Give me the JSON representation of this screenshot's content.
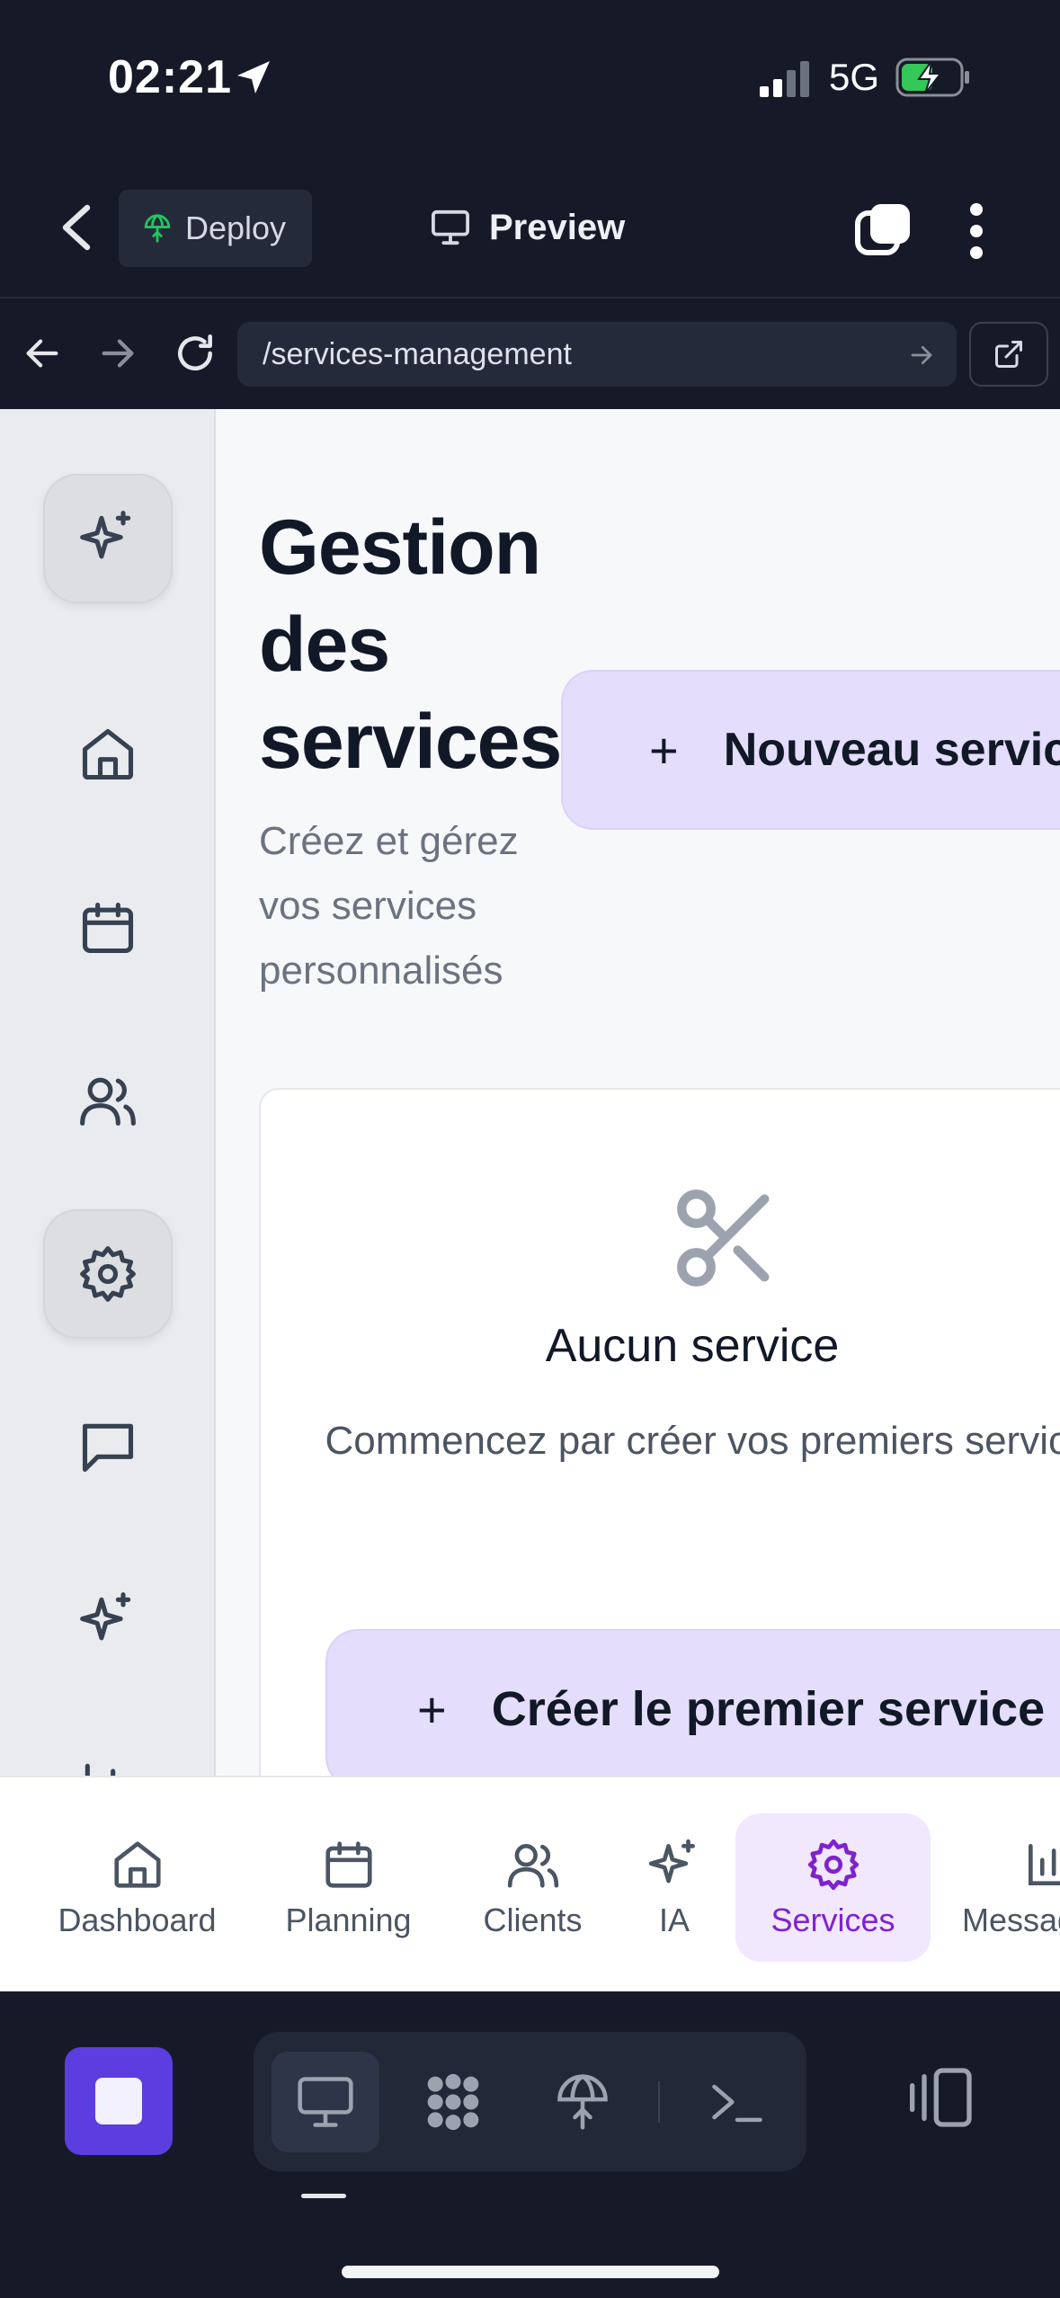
{
  "status": {
    "time": "02:21",
    "network": "5G"
  },
  "header": {
    "deploy_label": "Deploy",
    "preview_label": "Preview"
  },
  "browser": {
    "url": "/services-management"
  },
  "page": {
    "title": "Gestion des services",
    "subtitle": "Créez et gérez vos services personnalisés",
    "new_button": "Nouveau service",
    "new_button_icon": "+"
  },
  "empty_state": {
    "title": "Aucun service",
    "description": "Commencez par créer vos premiers services",
    "button": "Créer le premier service",
    "button_icon": "+"
  },
  "bottom_nav": {
    "items": [
      {
        "label": "Dashboard",
        "icon": "home-icon"
      },
      {
        "label": "Planning",
        "icon": "calendar-icon"
      },
      {
        "label": "Clients",
        "icon": "users-icon"
      },
      {
        "label": "IA",
        "icon": "sparkles-icon"
      },
      {
        "label": "Services",
        "icon": "gear-icon",
        "active": true
      },
      {
        "label": "Messages",
        "icon": "chart-icon"
      }
    ]
  },
  "colors": {
    "accent": "#7e22ce",
    "accent_soft": "#e4ddfb",
    "stop_button": "#5b3de0",
    "deploy_icon": "#22c55e"
  }
}
